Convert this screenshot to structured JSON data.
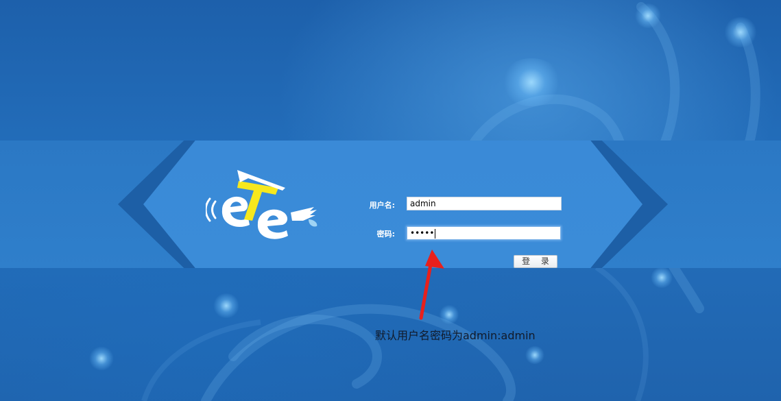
{
  "login_form": {
    "username_label": "用户名:",
    "username_value": "admin",
    "password_label": "密码:",
    "password_mask": "•••••",
    "login_button": "登 录"
  },
  "annotation": {
    "text": "默认用户名密码为admin:admin"
  },
  "colors": {
    "background": "#1f63ad",
    "panel": "#3b8cd8",
    "arrow": "#e8201c",
    "logo_yellow": "#f7e81d"
  },
  "icons": {
    "logo": "ete-logo",
    "arrow": "red-arrow-icon"
  }
}
